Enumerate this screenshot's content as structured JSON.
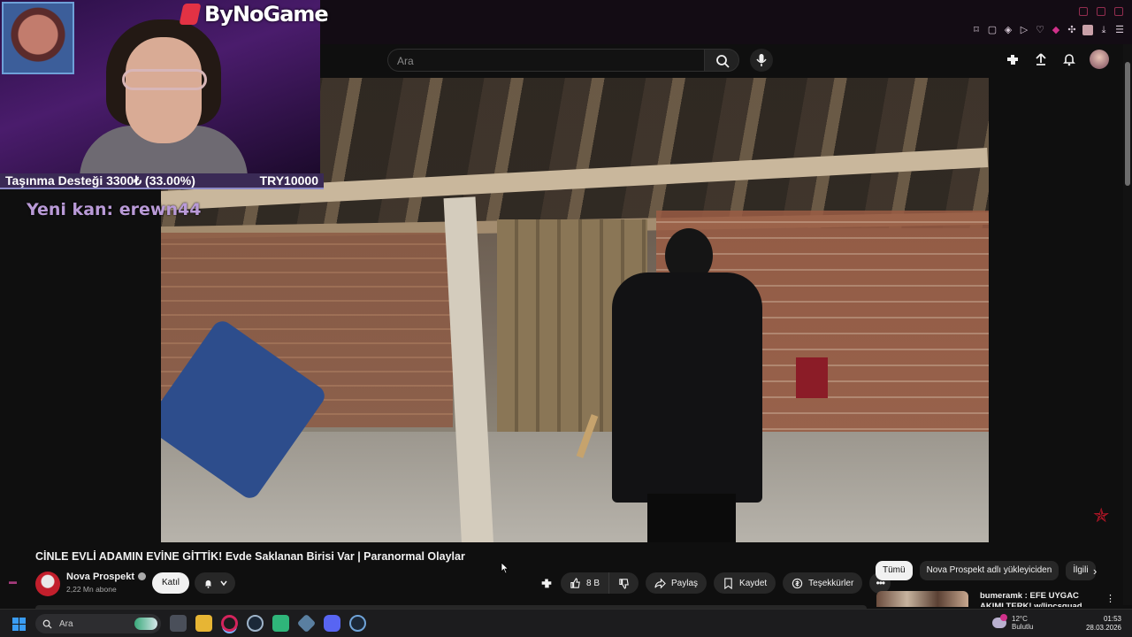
{
  "overlay": {
    "brand": "ByNoGame",
    "donation_label": "Taşınma Desteği 3300₺ (33.00%)",
    "donation_goal": "TRY10000",
    "donation_progress": 0.33,
    "new_member": "Yeni kan: erewn44"
  },
  "header": {
    "search_placeholder": "Ara"
  },
  "video": {
    "title": "CİNLE EVLİ ADAMIN EVİNE GİTTİK! Evde Saklanan Birisi Var | Paranormal Olaylar"
  },
  "channel": {
    "name": "Nova Prospekt",
    "subscribers": "2,22 Mn abone",
    "join_label": "Katıl"
  },
  "actions": {
    "likes": "8 B",
    "share": "Paylaş",
    "save": "Kaydet",
    "thanks": "Teşekkürler"
  },
  "suggestions": {
    "chips": [
      "Tümü",
      "Nova Prospekt adlı yükleyiciden",
      "İlgili"
    ],
    "first_title": "bumeramk : EFE UYGAC AKIMI TERK! w/lipcsquad"
  },
  "taskbar": {
    "search_label": "Ara",
    "temperature": "12°C",
    "weather": "Bulutlu",
    "time": "01:53",
    "date": "28.03.2026"
  },
  "colors": {
    "accent": "#e33244",
    "background": "#0f0f0f",
    "pill": "#272727"
  }
}
